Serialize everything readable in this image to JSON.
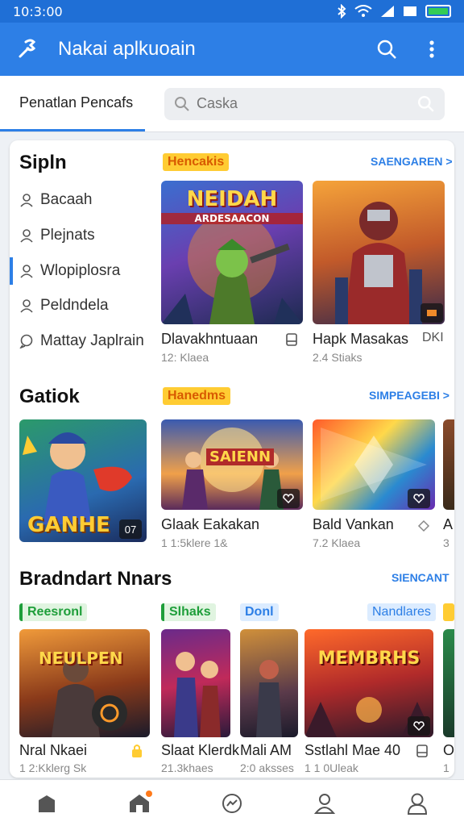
{
  "status": {
    "time": "10:3:00"
  },
  "appbar": {
    "title": "Nakai aplkuoain"
  },
  "tabs": {
    "active": "Penatlan Pencafs"
  },
  "search": {
    "placeholder": "Caska"
  },
  "sidebar": {
    "title": "Sipln",
    "items": [
      {
        "label": "Bacaah"
      },
      {
        "label": "Plejnats"
      },
      {
        "label": "Wlopiplosra"
      },
      {
        "label": "Peldndela"
      },
      {
        "label": "Mattay Japlrain"
      }
    ]
  },
  "section1": {
    "badge": "Hencakis",
    "see_all": "SAENGAREN >",
    "games": [
      {
        "name": "Dlavakhntuaan",
        "sub": "12: Klaea",
        "art_text": "NEIDAH",
        "art_sub": "ARDESAACON"
      },
      {
        "name": "Hapk Masakas",
        "sub": "2.4 Stiaks",
        "extra": "DKI"
      }
    ]
  },
  "section2": {
    "title": "Gatiok",
    "badge": "Hanedms",
    "see_all": "SIMPEAGEBI >",
    "games": [
      {
        "name": "",
        "sub": "",
        "art_text": "GANHE",
        "corner": "07"
      },
      {
        "name": "Glaak Eakakan",
        "sub": "1 1:5klere 1&",
        "art_text": "SAIENN"
      },
      {
        "name": "Bald Vankan",
        "sub": "7.2 Klaea"
      },
      {
        "name": "A",
        "sub": "3"
      }
    ]
  },
  "section3": {
    "title": "Bradndart Nnars",
    "see_all": "SIENCANT",
    "badges": [
      "Reesronl",
      "Slhaks",
      "Donl",
      "Nandlares"
    ],
    "games": [
      {
        "name": "Nral Nkaei",
        "sub": "1 2:Kklerg  Sk",
        "art_text": "NEULPEN"
      },
      {
        "name": "Slaat Klerdk",
        "sub": "21.3khaes"
      },
      {
        "name": "Mali AM",
        "sub": "2:0 aksses"
      },
      {
        "name": "Sstlahl Mae 40",
        "sub": "1 1 0Uleak",
        "art_text": "MEMBRHS"
      },
      {
        "name": "O",
        "sub": "1"
      }
    ]
  },
  "colors": {
    "primary": "#2d7fe6",
    "status_bar": "#1f6fd6",
    "badge_orange": "#ffcc33",
    "badge_green": "#1e9e3a"
  },
  "nav": [
    "home-icon",
    "store-icon",
    "activity-icon",
    "profile-icon",
    "account-icon"
  ]
}
